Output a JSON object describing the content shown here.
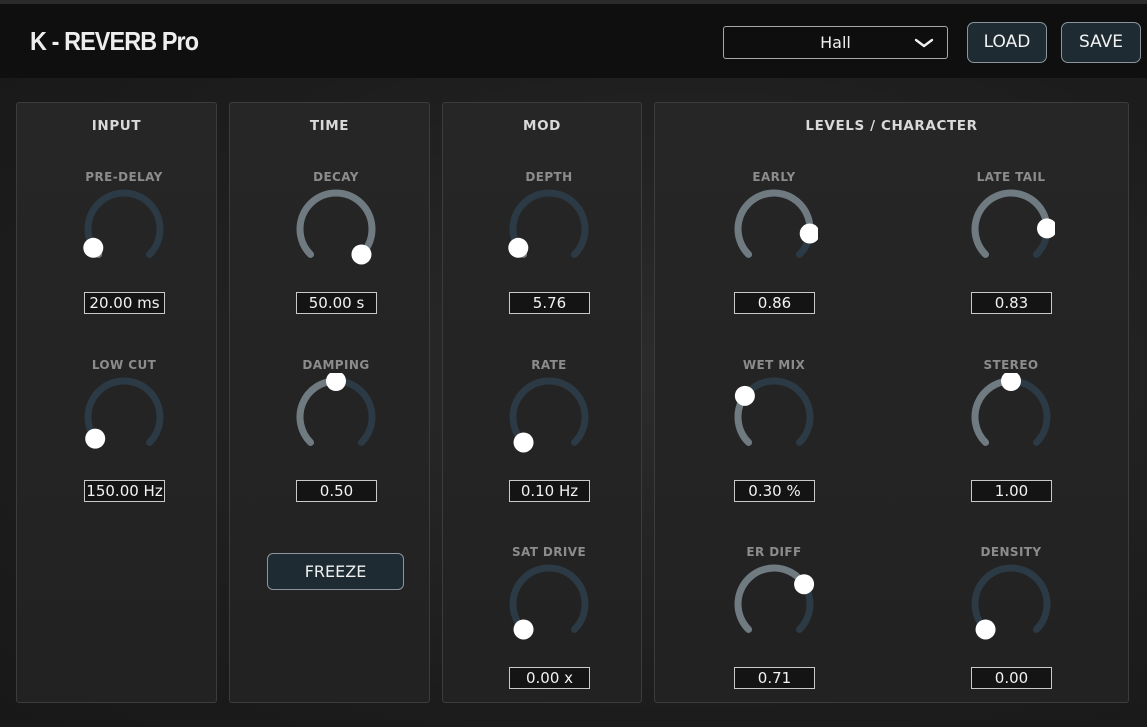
{
  "app": {
    "title": "K - REVERB Pro",
    "preset": "Hall",
    "load_label": "LOAD",
    "save_label": "SAVE"
  },
  "colors": {
    "track": "#2b3a44",
    "fill": "#6f7b81",
    "handle": "#ffffff",
    "button_bg": "#1f2b32"
  },
  "panels": {
    "input": {
      "title": "INPUT",
      "pre_delay": {
        "label": "PRE-DELAY",
        "display": "20.00 ms",
        "level": 0.05
      },
      "low_cut": {
        "label": "LOW CUT",
        "display": "150.00 Hz",
        "level": 0.03
      }
    },
    "time": {
      "title": "TIME",
      "decay": {
        "label": "DECAY",
        "display": "50.00 s",
        "level": 1.0
      },
      "damping": {
        "label": "DAMPING",
        "display": "0.50",
        "level": 0.5
      },
      "freeze_label": "FREEZE"
    },
    "mod": {
      "title": "MOD",
      "depth": {
        "label": "DEPTH",
        "display": "5.76",
        "level": 0.05
      },
      "rate": {
        "label": "RATE",
        "display": "0.10 Hz",
        "level": 0.0
      },
      "sat_drive": {
        "label": "SAT DRIVE",
        "display": "0.00 x",
        "level": 0.0
      }
    },
    "levels": {
      "title": "LEVELS / CHARACTER",
      "early": {
        "label": "EARLY",
        "display": "0.86",
        "level": 0.86
      },
      "late_tail": {
        "label": "LATE TAIL",
        "display": "0.83",
        "level": 0.83
      },
      "wet_mix": {
        "label": "WET MIX",
        "display": "0.30 %",
        "level": 0.3
      },
      "stereo": {
        "label": "STEREO",
        "display": "1.00",
        "level": 0.5
      },
      "er_diff": {
        "label": "ER DIFF",
        "display": "0.71",
        "level": 0.71
      },
      "density": {
        "label": "DENSITY",
        "display": "0.00",
        "level": 0.0
      }
    }
  }
}
